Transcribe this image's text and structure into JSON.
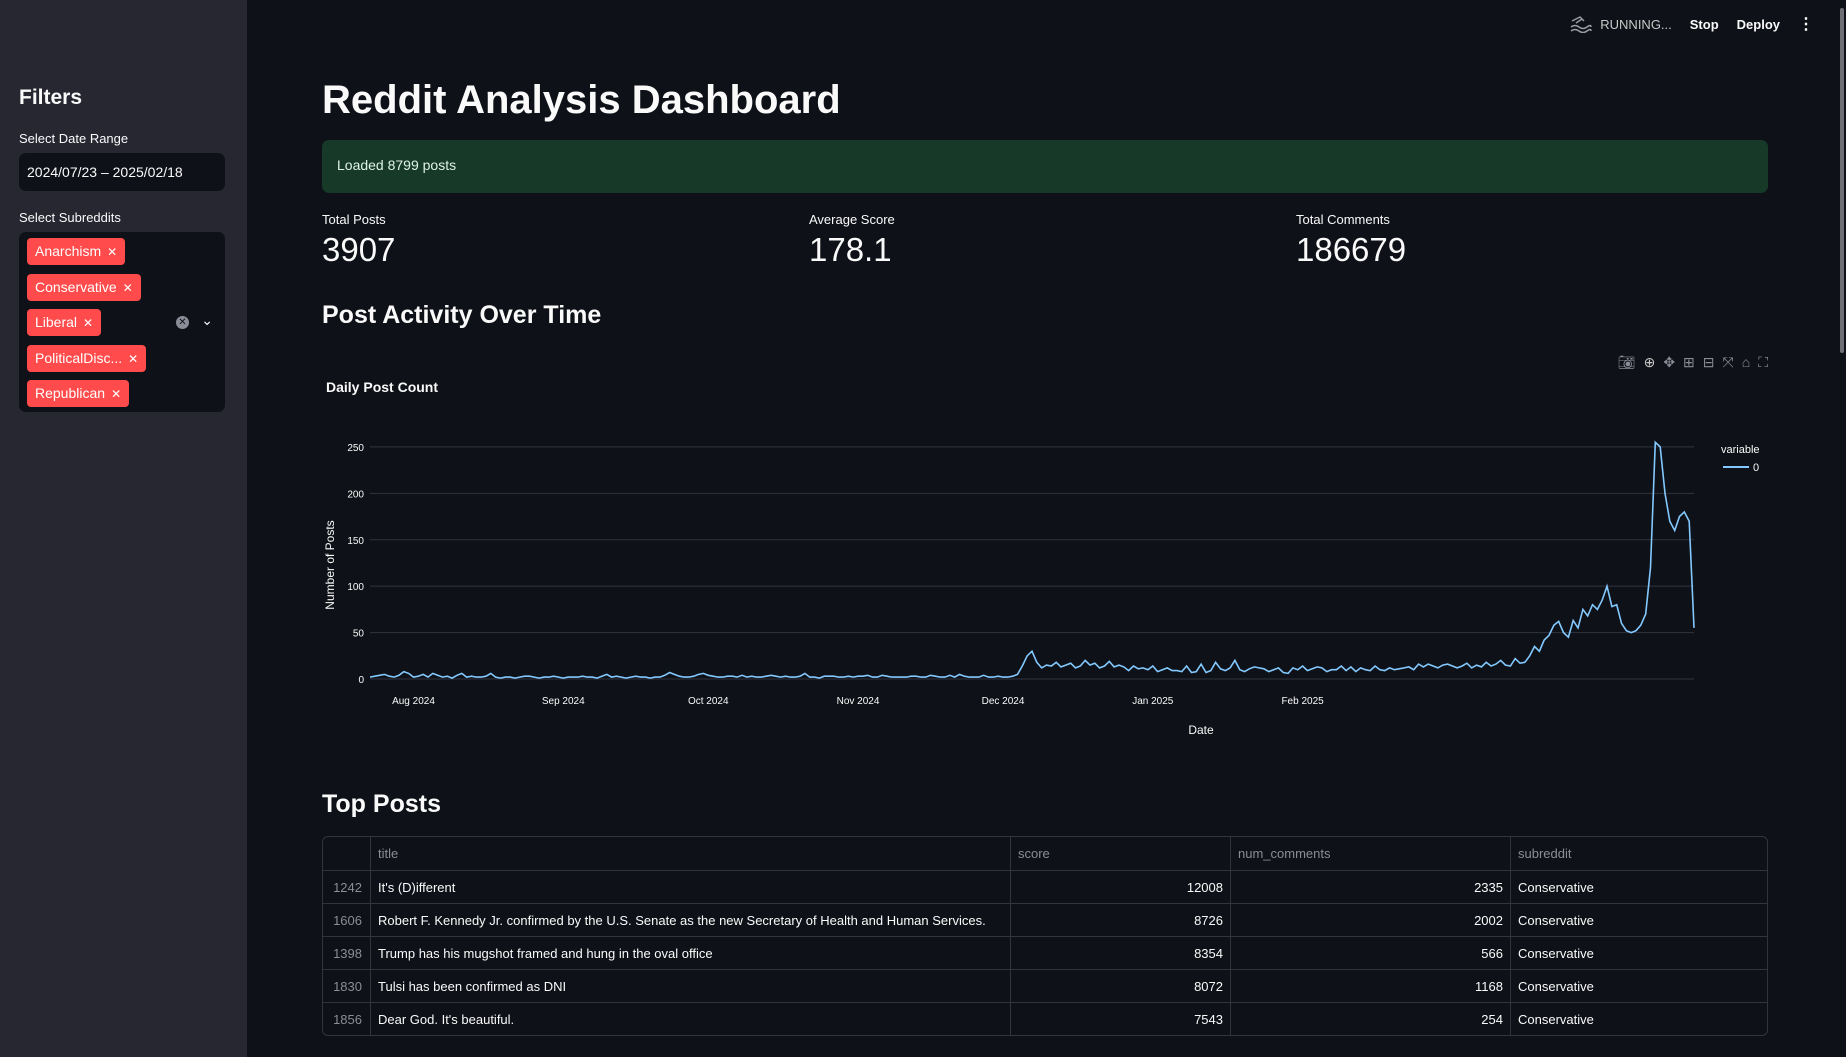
{
  "header": {
    "status": "RUNNING...",
    "stop": "Stop",
    "deploy": "Deploy"
  },
  "sidebar": {
    "title": "Filters",
    "date_label": "Select Date Range",
    "date_value": "2024/07/23 – 2025/02/18",
    "subreddit_label": "Select Subreddits",
    "subreddits": [
      "Anarchism",
      "Conservative",
      "Liberal",
      "PoliticalDisc...",
      "Republican"
    ]
  },
  "main": {
    "title": "Reddit Analysis Dashboard",
    "success": "Loaded 8799 posts",
    "metrics": [
      {
        "label": "Total Posts",
        "value": "3907"
      },
      {
        "label": "Average Score",
        "value": "178.1"
      },
      {
        "label": "Total Comments",
        "value": "186679"
      }
    ],
    "activity_heading": "Post Activity Over Time",
    "top_heading": "Top Posts"
  },
  "chart_data": {
    "type": "line",
    "title": "Daily Post Count",
    "xlabel": "Date",
    "ylabel": "Number of Posts",
    "legend_title": "variable",
    "legend_position": "top-right",
    "grid": true,
    "ylim": [
      0,
      265
    ],
    "yticks": [
      0,
      50,
      100,
      150,
      200,
      250
    ],
    "xticks": [
      "Aug 2024",
      "Sep 2024",
      "Oct 2024",
      "Nov 2024",
      "Dec 2024",
      "Jan 2025",
      "Feb 2025"
    ],
    "x_start": "2024-07-23",
    "series": [
      {
        "name": "0",
        "color": "#83c9ff",
        "values": [
          2,
          3,
          4,
          5,
          3,
          2,
          4,
          8,
          6,
          2,
          3,
          5,
          2,
          6,
          4,
          2,
          3,
          1,
          4,
          6,
          2,
          3,
          2,
          2,
          3,
          6,
          2,
          1,
          2,
          2,
          1,
          2,
          3,
          3,
          2,
          1,
          2,
          2,
          3,
          2,
          1,
          2,
          2,
          2,
          3,
          2,
          2,
          1,
          3,
          5,
          2,
          3,
          2,
          1,
          2,
          3,
          2,
          2,
          1,
          2,
          2,
          4,
          7,
          5,
          3,
          2,
          2,
          3,
          5,
          6,
          4,
          3,
          2,
          2,
          3,
          3,
          2,
          4,
          2,
          3,
          2,
          2,
          3,
          4,
          3,
          2,
          3,
          2,
          2,
          3,
          6,
          2,
          2,
          1,
          3,
          3,
          3,
          2,
          2,
          3,
          2,
          3,
          3,
          4,
          2,
          2,
          4,
          3,
          2,
          2,
          2,
          2,
          3,
          3,
          2,
          2,
          4,
          3,
          2,
          2,
          4,
          2,
          5,
          3,
          2,
          2,
          2,
          4,
          2,
          2,
          3,
          2,
          2,
          3,
          5,
          14,
          25,
          30,
          18,
          12,
          15,
          14,
          18,
          13,
          15,
          17,
          12,
          14,
          20,
          15,
          17,
          12,
          14,
          19,
          13,
          15,
          13,
          9,
          14,
          11,
          12,
          10,
          14,
          8,
          10,
          12,
          9,
          9,
          8,
          14,
          7,
          8,
          16,
          7,
          9,
          18,
          11,
          9,
          12,
          20,
          10,
          8,
          11,
          13,
          12,
          11,
          8,
          10,
          12,
          7,
          6,
          12,
          10,
          14,
          9,
          11,
          13,
          12,
          8,
          10,
          10,
          14,
          9,
          13,
          8,
          12,
          10,
          9,
          14,
          10,
          9,
          12,
          10,
          11,
          12,
          13,
          10,
          16,
          13,
          16,
          14,
          12,
          15,
          16,
          14,
          12,
          14,
          17,
          12,
          15,
          13,
          18,
          14,
          16,
          20,
          15,
          14,
          22,
          17,
          18,
          25,
          35,
          30,
          42,
          47,
          58,
          62,
          50,
          45,
          63,
          55,
          75,
          68,
          80,
          75,
          85,
          100,
          78,
          80,
          60,
          52,
          50,
          52,
          58,
          70,
          120,
          255,
          250,
          200,
          170,
          160,
          175,
          180,
          170,
          55
        ]
      }
    ]
  },
  "table": {
    "columns": [
      "",
      "title",
      "score",
      "num_comments",
      "subreddit"
    ],
    "rows": [
      {
        "idx": "1242",
        "title": "It's (D)ifferent",
        "score": "12008",
        "num_comments": "2335",
        "subreddit": "Conservative"
      },
      {
        "idx": "1606",
        "title": "Robert F. Kennedy Jr. confirmed by the U.S. Senate as the new Secretary of Health and Human Services.",
        "score": "8726",
        "num_comments": "2002",
        "subreddit": "Conservative"
      },
      {
        "idx": "1398",
        "title": "Trump has his mugshot framed and hung in the oval office",
        "score": "8354",
        "num_comments": "566",
        "subreddit": "Conservative"
      },
      {
        "idx": "1830",
        "title": "Tulsi has been confirmed as DNI",
        "score": "8072",
        "num_comments": "1168",
        "subreddit": "Conservative"
      },
      {
        "idx": "1856",
        "title": "Dear God. It's beautiful.",
        "score": "7543",
        "num_comments": "254",
        "subreddit": "Conservative"
      }
    ]
  }
}
